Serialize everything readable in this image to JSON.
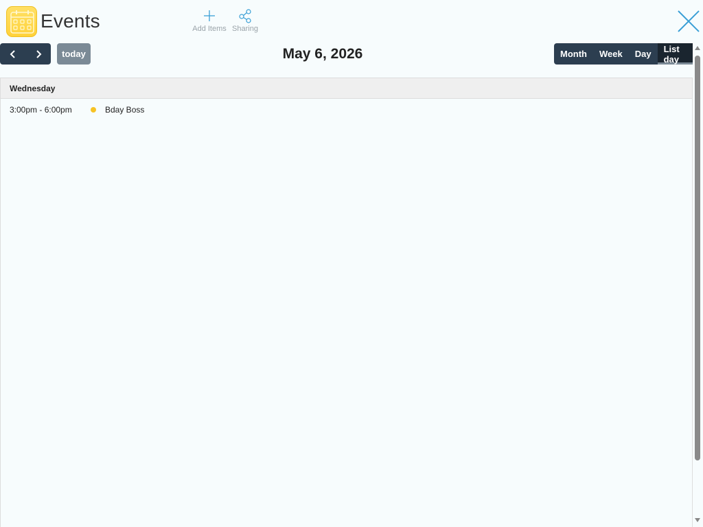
{
  "app": {
    "title": "Events",
    "icon": "calendar-icon"
  },
  "toolbar": {
    "add_items_label": "Add Items",
    "add_items_icon": "plus-icon",
    "sharing_label": "Sharing",
    "sharing_icon": "share-icon",
    "close_icon": "close-icon"
  },
  "calendar": {
    "prev_icon": "chevron-left-icon",
    "next_icon": "chevron-right-icon",
    "today_label": "today",
    "date_title": "May 6, 2026",
    "views": [
      {
        "label": "Month",
        "active": false
      },
      {
        "label": "Week",
        "active": false
      },
      {
        "label": "Day",
        "active": false
      },
      {
        "label": "List day",
        "active": true
      }
    ]
  },
  "list": {
    "day_header": "Wednesday",
    "events": [
      {
        "time": "3:00pm - 6:00pm",
        "title": "Bday Boss",
        "color": "#f7c325"
      }
    ]
  },
  "colors": {
    "toolbar_dark": "#2c3e50",
    "today_gray": "#7b8a96",
    "accent_blue": "#3a9fd6",
    "app_icon_yellow": "#ffd23a"
  }
}
